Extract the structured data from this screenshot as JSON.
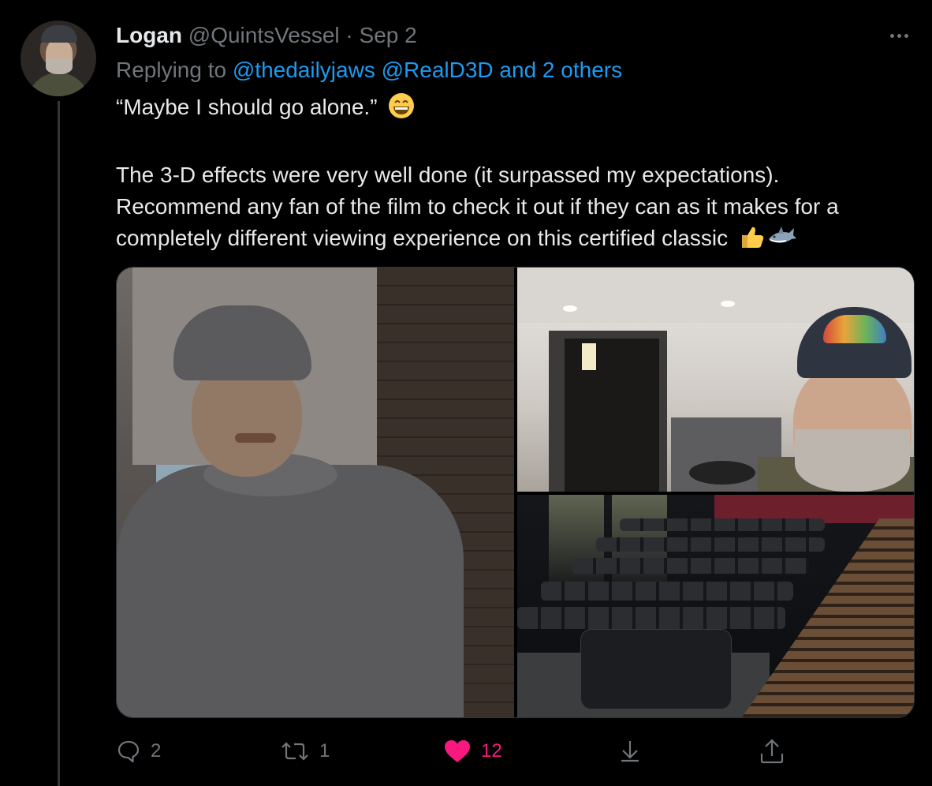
{
  "tweet": {
    "display_name": "Logan",
    "handle": "@QuintsVessel",
    "separator": "·",
    "date": "Sep 2",
    "replying_prefix": "Replying to",
    "replying_mentions": [
      "@thedailyjaws",
      "@RealD3D",
      "and 2 others"
    ],
    "text_line_1": "“Maybe I should go alone.”",
    "text_line_1_emoji": "grinning-face",
    "text_line_2": "The 3-D effects were very well done (it surpassed my expectations).",
    "text_line_3": "Recommend any fan of the film to check it out if they can as it makes for a",
    "text_line_4": "completely different viewing experience on this certified classic",
    "text_line_4_emojis": [
      "thumbs-up",
      "shark"
    ]
  },
  "media": {
    "count": 3,
    "images": [
      {
        "subject": "man-in-grey-sweater-and-cap"
      },
      {
        "subject": "selfie-in-theater-hallway"
      },
      {
        "subject": "theater-recliner-seating"
      }
    ]
  },
  "actions": {
    "reply_count": "2",
    "retweet_count": "1",
    "like_count": "12",
    "liked": true
  },
  "colors": {
    "background": "#000000",
    "text_primary": "#e7e9ea",
    "text_secondary": "#71767b",
    "link": "#1d9bf0",
    "like": "#f91880"
  }
}
